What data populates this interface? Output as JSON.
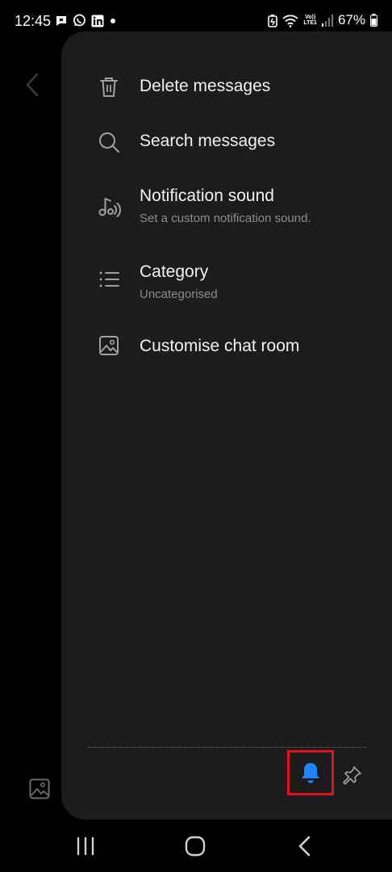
{
  "status_bar": {
    "time": "12:45",
    "left_icons": [
      "chat-notification-icon",
      "whatsapp-icon",
      "linkedin-icon",
      "dot-icon"
    ],
    "right_icons": [
      "battery-saver-icon",
      "wifi-icon",
      "volte-icon",
      "signal-icon",
      "battery-icon"
    ],
    "volte_line1": "Vo))",
    "volte_line2": "LTE1",
    "battery": "67%"
  },
  "drawer": {
    "menu": [
      {
        "icon": "trash-icon",
        "title": "Delete messages",
        "subtitle": ""
      },
      {
        "icon": "search-icon",
        "title": "Search messages",
        "subtitle": ""
      },
      {
        "icon": "music-note-icon",
        "title": "Notification sound",
        "subtitle": "Set a custom notification sound."
      },
      {
        "icon": "list-icon",
        "title": "Category",
        "subtitle": "Uncategorised"
      },
      {
        "icon": "image-icon",
        "title": "Customise chat room",
        "subtitle": ""
      }
    ],
    "bottom_actions": [
      {
        "icon": "bell-icon",
        "state": "on",
        "highlighted": true
      },
      {
        "icon": "pin-icon",
        "state": "off"
      }
    ]
  },
  "nav_bar": {
    "buttons": [
      "recents-icon",
      "home-icon",
      "back-icon"
    ]
  },
  "colors": {
    "drawer_bg": "#1c1c1c",
    "accent_blue": "#1d86ff",
    "highlight_red": "#e0121a",
    "subtitle_gray": "#8c8c8c"
  }
}
